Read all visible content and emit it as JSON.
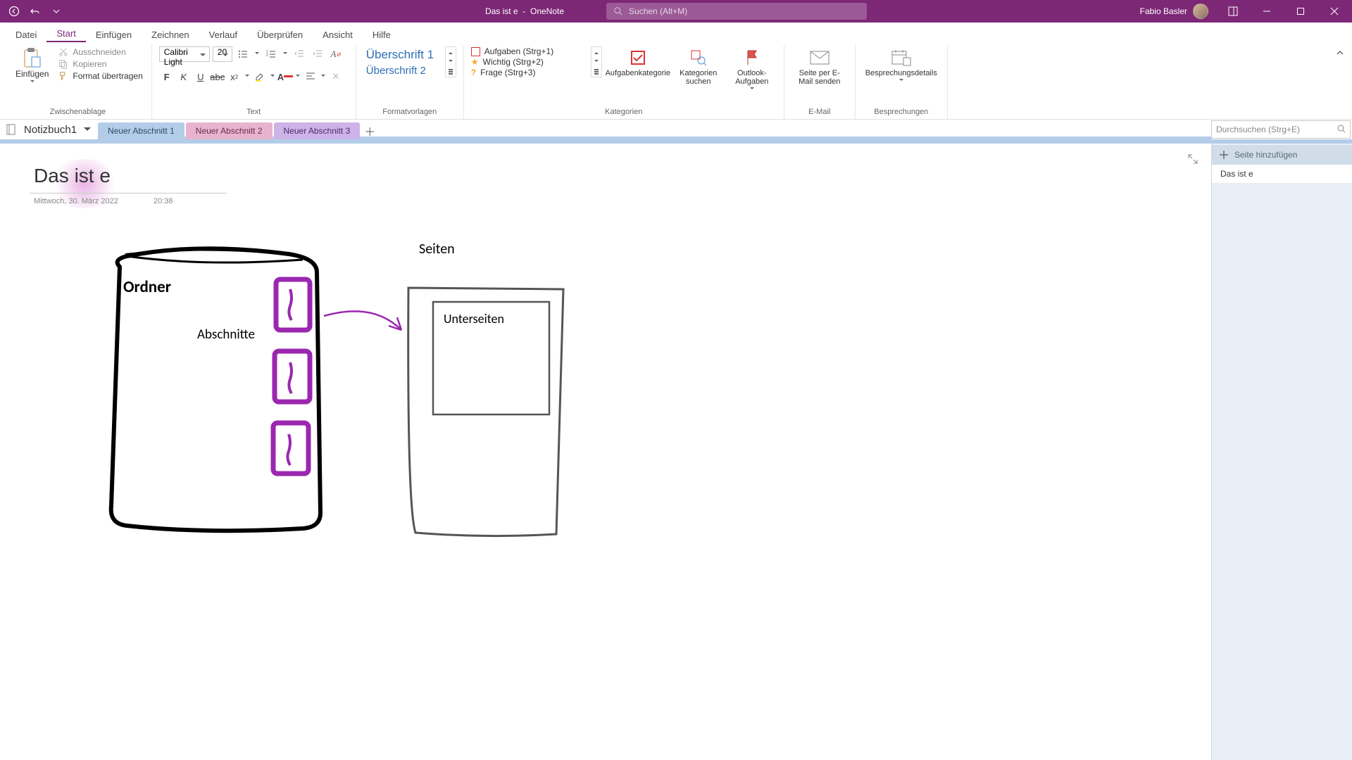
{
  "titlebar": {
    "doc_title": "Das ist e",
    "app_name": "OneNote",
    "search_placeholder": "Suchen (Alt+M)",
    "user_name": "Fabio Basler"
  },
  "ribbon_tabs": [
    "Datei",
    "Start",
    "Einfügen",
    "Zeichnen",
    "Verlauf",
    "Überprüfen",
    "Ansicht",
    "Hilfe"
  ],
  "active_tab_index": 1,
  "ribbon": {
    "clipboard": {
      "paste": "Einfügen",
      "cut": "Ausschneiden",
      "copy": "Kopieren",
      "format_painter": "Format übertragen",
      "group_label": "Zwischenablage"
    },
    "text": {
      "font_name": "Calibri Light",
      "font_size": "20",
      "group_label": "Text"
    },
    "styles": {
      "item1": "Überschrift 1",
      "item2": "Überschrift 2",
      "group_label": "Formatvorlagen"
    },
    "categories": {
      "task": "Aufgaben (Strg+1)",
      "important": "Wichtig (Strg+2)",
      "question": "Frage (Strg+3)",
      "task_cat": "Aufgabenkategorie",
      "search_cat": "Kategorien suchen",
      "outlook": "Outlook-Aufgaben",
      "group_label": "Kategorien"
    },
    "email": {
      "send": "Seite per E-Mail senden",
      "group_label": "E-Mail"
    },
    "meetings": {
      "details": "Besprechungsdetails",
      "group_label": "Besprechungen"
    }
  },
  "notebook": {
    "name": "Notizbuch1",
    "sections": [
      "Neuer Abschnitt 1",
      "Neuer Abschnitt 2",
      "Neuer Abschnitt 3"
    ]
  },
  "page": {
    "title": "Das ist e",
    "date": "Mittwoch, 30. März 2022",
    "time": "20:38",
    "drawing": {
      "ordner": "Ordner",
      "abschnitte": "Abschnitte",
      "seiten": "Seiten",
      "unterseiten": "Unterseiten"
    }
  },
  "page_panel": {
    "search_placeholder": "Durchsuchen (Strg+E)",
    "add_page": "Seite hinzufügen",
    "pages": [
      "Das ist e"
    ]
  }
}
